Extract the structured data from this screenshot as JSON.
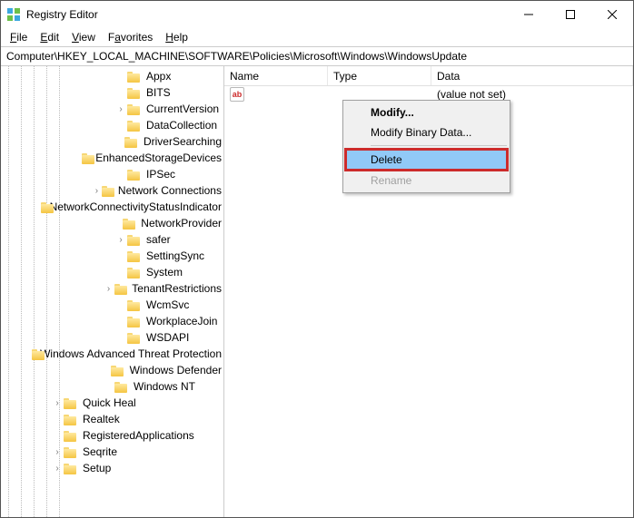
{
  "window": {
    "title": "Registry Editor"
  },
  "menu": {
    "file": "File",
    "edit": "Edit",
    "view": "View",
    "favorites": "Favorites",
    "help": "Help"
  },
  "address": {
    "value": "Computer\\HKEY_LOCAL_MACHINE\\SOFTWARE\\Policies\\Microsoft\\Windows\\WindowsUpdate"
  },
  "tree": {
    "items": [
      {
        "depth": 9,
        "expander": "",
        "label": "Appx"
      },
      {
        "depth": 9,
        "expander": "",
        "label": "BITS"
      },
      {
        "depth": 9,
        "expander": ">",
        "label": "CurrentVersion"
      },
      {
        "depth": 9,
        "expander": "",
        "label": "DataCollection"
      },
      {
        "depth": 9,
        "expander": "",
        "label": "DriverSearching"
      },
      {
        "depth": 9,
        "expander": "",
        "label": "EnhancedStorageDevices"
      },
      {
        "depth": 9,
        "expander": "",
        "label": "IPSec"
      },
      {
        "depth": 9,
        "expander": ">",
        "label": "Network Connections"
      },
      {
        "depth": 9,
        "expander": "",
        "label": "NetworkConnectivityStatusIndicator"
      },
      {
        "depth": 9,
        "expander": "",
        "label": "NetworkProvider"
      },
      {
        "depth": 9,
        "expander": ">",
        "label": "safer"
      },
      {
        "depth": 9,
        "expander": "",
        "label": "SettingSync"
      },
      {
        "depth": 9,
        "expander": "",
        "label": "System"
      },
      {
        "depth": 9,
        "expander": ">",
        "label": "TenantRestrictions"
      },
      {
        "depth": 9,
        "expander": "",
        "label": "WcmSvc"
      },
      {
        "depth": 9,
        "expander": "",
        "label": "WorkplaceJoin"
      },
      {
        "depth": 9,
        "expander": "",
        "label": "WSDAPI"
      },
      {
        "depth": 8,
        "expander": "",
        "label": "Windows Advanced Threat Protection"
      },
      {
        "depth": 8,
        "expander": "",
        "label": "Windows Defender"
      },
      {
        "depth": 8,
        "expander": "",
        "label": "Windows NT"
      },
      {
        "depth": 4,
        "expander": ">",
        "label": "Quick Heal"
      },
      {
        "depth": 4,
        "expander": "",
        "label": "Realtek"
      },
      {
        "depth": 4,
        "expander": "",
        "label": "RegisteredApplications"
      },
      {
        "depth": 4,
        "expander": ">",
        "label": "Seqrite"
      },
      {
        "depth": 4,
        "expander": ">",
        "label": "Setup"
      }
    ]
  },
  "list": {
    "columns": {
      "name": "Name",
      "type": "Type",
      "data": "Data"
    },
    "rows": [
      {
        "icon": "ab",
        "name": "",
        "type": "",
        "data": "(value not set)"
      }
    ]
  },
  "contextMenu": {
    "modify": "Modify...",
    "modifyBinary": "Modify Binary Data...",
    "delete": "Delete",
    "rename": "Rename"
  }
}
